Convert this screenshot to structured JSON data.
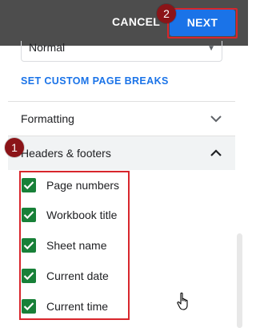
{
  "toolbar": {
    "cancel_label": "CANCEL",
    "next_label": "NEXT"
  },
  "badges": {
    "first": "1",
    "second": "2"
  },
  "page_setup": {
    "scale_value": "Normal",
    "custom_breaks_link": "SET CUSTOM PAGE BREAKS"
  },
  "sections": {
    "formatting": "Formatting",
    "headers_footers": "Headers & footers"
  },
  "header_footer_options": [
    {
      "label": "Page numbers",
      "checked": true
    },
    {
      "label": "Workbook title",
      "checked": true
    },
    {
      "label": "Sheet name",
      "checked": true
    },
    {
      "label": "Current date",
      "checked": true
    },
    {
      "label": "Current time",
      "checked": true
    }
  ],
  "colors": {
    "accent": "#1a73e8",
    "checkbox": "#188038",
    "highlight": "#d8262c",
    "topbar": "#4d4d4d"
  }
}
